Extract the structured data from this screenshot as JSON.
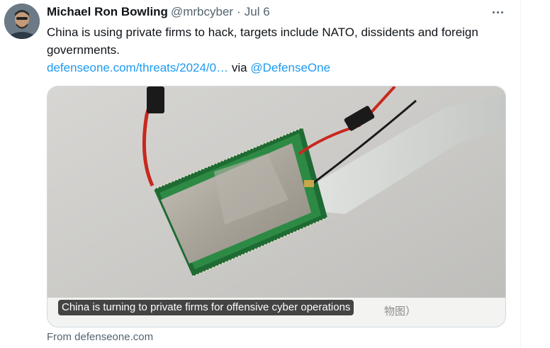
{
  "tweet": {
    "author_name": "Michael Ron Bowling",
    "handle": "@mrbcyber",
    "separator": "·",
    "date": "Jul 6",
    "text": "China is using private firms to hack, targets include NATO, dissidents and foreign governments.",
    "link_text": "defenseone.com/threats/2024/0…",
    "via_text": "via",
    "via_handle": "@DefenseOne"
  },
  "card": {
    "caption": "China is turning to private firms for offensive cyber operations",
    "photo_text": "物图）",
    "source": "From defenseone.com"
  },
  "icons": {
    "more": "more-horizontal-icon",
    "avatar": "user-avatar"
  },
  "colors": {
    "link": "#1d9bf0",
    "secondary_text": "#536471",
    "border": "#cfd9de"
  }
}
